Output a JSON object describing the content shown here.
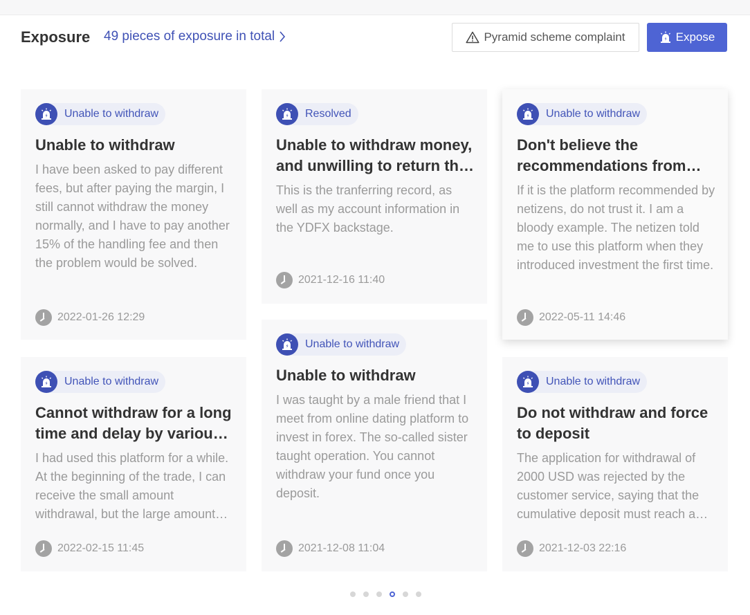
{
  "header": {
    "title": "Exposure",
    "count_link": "49 pieces of exposure in total",
    "complaint_button": "Pyramid scheme complaint",
    "expose_button": "Expose"
  },
  "cards": [
    {
      "badge": "Unable to withdraw",
      "title": "Unable to withdraw",
      "description": "I have been asked to pay different fees, but after paying the margin, I still cannot withdraw the money normally, and I have to pay another 15% of the handling fee and then the problem would be solved.",
      "time": "2022-01-26 12:29"
    },
    {
      "badge": "Resolved",
      "title": "Unable to withdraw money, and unwilling to return the funds",
      "description": "This is the tranferring record, as well as my account information in the YDFX backstage.",
      "time": "2021-12-16 11:40"
    },
    {
      "badge": "Unable to withdraw",
      "title": "Don't believe the recommendations from netizens",
      "description": "If it is the platform recommended by netizens, do not trust it. I am a bloody example. The netizen told me to use this platform when they introduced investment the first time.",
      "time": "2022-05-11 14:46"
    },
    {
      "badge": "Unable to withdraw",
      "title": "Cannot withdraw for a long time and delay by various excuses",
      "description": "I had used this platform for a while. At the beginning of the trade, I can receive the small amount withdrawal, but the large amount cannot be withdrawn.",
      "time": "2022-02-15 11:45"
    },
    {
      "badge": "Unable to withdraw",
      "title": "Unable to withdraw",
      "description": "I was taught by a male friend that I meet from online dating platform to invest in forex. The so-called sister taught operation. You cannot withdraw your fund once you deposit.",
      "time": "2021-12-08 11:04"
    },
    {
      "badge": "Unable to withdraw",
      "title": "Do not withdraw and force to deposit",
      "description": "The application for withdrawal of 2000 USD was rejected by the customer service, saying that the cumulative deposit must reach a certain amount.",
      "time": "2021-12-03 22:16"
    }
  ],
  "pagination": {
    "total_pages": 6,
    "active_page": 4
  },
  "colors": {
    "accent": "#4e64d4",
    "badge_icon": "#3e50b4"
  }
}
